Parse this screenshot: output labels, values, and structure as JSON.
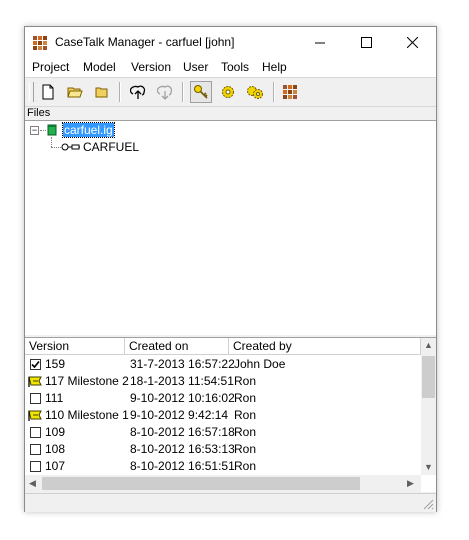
{
  "window": {
    "title": "CaseTalk Manager - carfuel [john]"
  },
  "menu": [
    "Project",
    "Model",
    "Version",
    "User",
    "Tools",
    "Help"
  ],
  "toolbar": {
    "icons": [
      "new-document-icon",
      "open-folder-icon",
      "folder-icon",
      "check-in-icon",
      "check-out-icon",
      "key-icon",
      "gear-key-icon",
      "gears-icon",
      "casetalk-app-icon"
    ]
  },
  "files": {
    "header": "Files",
    "tree": {
      "root_label": "carfuel.ig",
      "child_label": "CARFUEL",
      "expander": "−"
    }
  },
  "versions": {
    "columns": [
      "Version",
      "Created on",
      "Created by"
    ],
    "rows": [
      {
        "icon": "checked",
        "version": "159",
        "created_on": "31-7-2013 16:57:22",
        "created_by": "John Doe"
      },
      {
        "icon": "milestone",
        "version": "117 Milestone 2",
        "created_on": "18-1-2013 11:54:51",
        "created_by": "Ron"
      },
      {
        "icon": "unchecked",
        "version": "111",
        "created_on": "9-10-2012 10:16:02",
        "created_by": "Ron"
      },
      {
        "icon": "milestone",
        "version": "110 Milestone 1",
        "created_on": "9-10-2012 9:42:14",
        "created_by": "Ron"
      },
      {
        "icon": "unchecked",
        "version": "109",
        "created_on": "8-10-2012 16:57:18",
        "created_by": "Ron"
      },
      {
        "icon": "unchecked",
        "version": "108",
        "created_on": "8-10-2012 16:53:13",
        "created_by": "Ron"
      },
      {
        "icon": "unchecked",
        "version": "107",
        "created_on": "8-10-2012 16:51:51",
        "created_by": "Ron"
      }
    ]
  },
  "colors": {
    "selection": "#3399ff",
    "milestone_yellow": "#f2e600",
    "window_bg": "#f0f0f0"
  }
}
